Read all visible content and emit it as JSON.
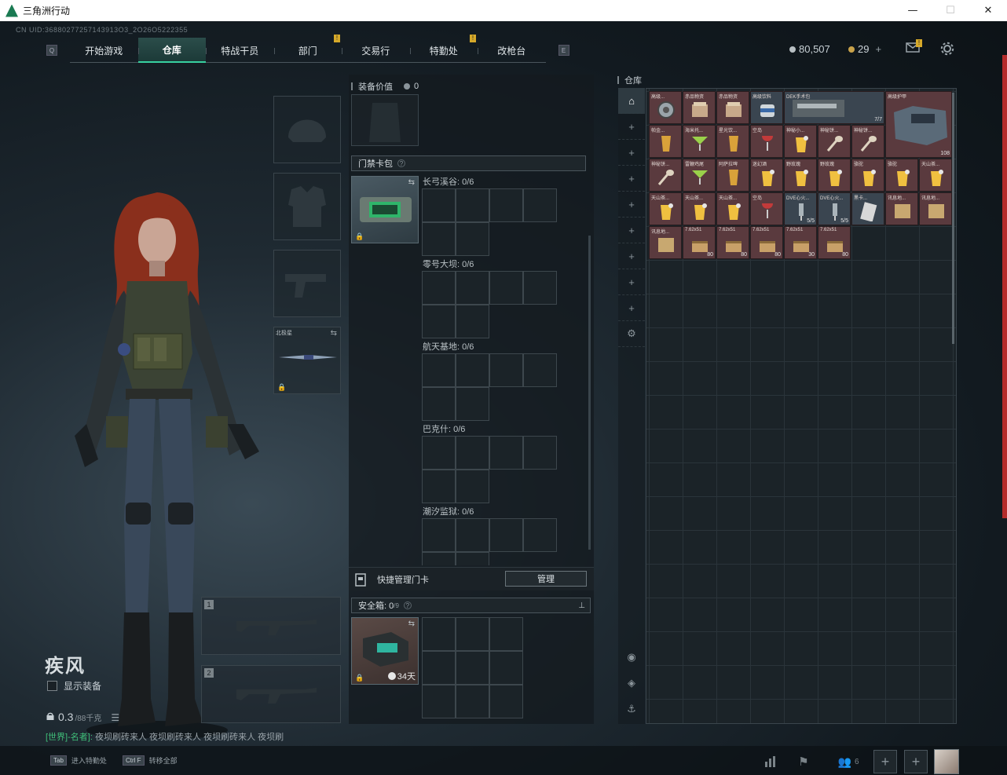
{
  "window": {
    "title": "三角洲行动",
    "controls": [
      "—",
      "☐",
      "✕"
    ]
  },
  "uid": "CN UID:36880277257143913O3_2O26O5222355",
  "nav": {
    "left_key": "Q",
    "right_key": "E",
    "tabs": [
      {
        "label": "开始游戏",
        "active": false,
        "warn": false
      },
      {
        "label": "仓库",
        "active": true,
        "warn": false
      },
      {
        "label": "特战干员",
        "active": false,
        "warn": false
      },
      {
        "label": "部门",
        "active": false,
        "warn": true
      },
      {
        "label": "交易行",
        "active": false,
        "warn": false
      },
      {
        "label": "特勤处",
        "active": false,
        "warn": true
      },
      {
        "label": "改枪台",
        "active": false,
        "warn": false
      }
    ],
    "warn_mark": "!"
  },
  "currency": {
    "silver": "80,507",
    "gold": "29",
    "add": "+",
    "silver_color": "#b9c0c4",
    "gold_color": "#c9a24a"
  },
  "top_icons": {
    "mail": "mail-icon",
    "mail_badge": "!",
    "settings": "gear-icon"
  },
  "character": {
    "name": "疾风",
    "show_equipment": "显示装备",
    "weight_value": "0.3",
    "weight_max": "/88千克"
  },
  "chat": {
    "channel": "[世界]-名者]:",
    "message": "夜坝刷砖来人 夜坝刷砖来人 夜坝刷砖来人 夜坝刷"
  },
  "gear_slots": {
    "melee_label": "北极星"
  },
  "weapon_slots": [
    "1",
    "2"
  ],
  "middle": {
    "equip_value_label": "装备价值",
    "equip_value": "0",
    "keycard_pack": "门禁卡包",
    "help": "?",
    "zones": [
      "长弓溪谷: 0/6",
      "零号大坝: 0/6",
      "航天基地: 0/6",
      "巴克什: 0/6",
      "潮汐监狱: 0/6"
    ],
    "quick_manage": "快捷管理门卡",
    "manage_btn": "管理",
    "safe_box": "安全箱: 0",
    "safe_box_cap": "/9",
    "safe_days": "34天",
    "pin": "📌"
  },
  "warehouse": {
    "title": "仓库",
    "items": [
      {
        "label": "高级...",
        "color": "red",
        "icon": "gear-round"
      },
      {
        "label": "赤品物资",
        "color": "red",
        "icon": "crate"
      },
      {
        "label": "赤品物资",
        "color": "red",
        "icon": "crate"
      },
      {
        "label": "高级饮料",
        "color": "blue",
        "icon": "can"
      },
      {
        "label": "DEK手术包",
        "color": "blue",
        "icon": "medkit",
        "count": "7/7",
        "wide": true
      },
      {
        "label": "高级护甲",
        "color": "red",
        "icon": "armor",
        "count": "108",
        "big": true
      },
      {
        "label": "帕金...",
        "color": "red",
        "icon": "glass"
      },
      {
        "label": "海米托...",
        "color": "red",
        "icon": "cocktail"
      },
      {
        "label": "星光饮...",
        "color": "red",
        "icon": "glass"
      },
      {
        "label": "空岛",
        "color": "red",
        "icon": "wine"
      },
      {
        "label": "神秘小... ",
        "color": "red",
        "icon": "juice"
      },
      {
        "label": "神秘饼...",
        "color": "red",
        "icon": "spoon"
      },
      {
        "label": "神秘饼...",
        "color": "red",
        "icon": "spoon"
      },
      {
        "label": "神秘饼...",
        "color": "red",
        "icon": "spoon"
      },
      {
        "label": "雷鞭鸡尾",
        "color": "red",
        "icon": "cocktail"
      },
      {
        "label": "阿萨拉啤",
        "color": "red",
        "icon": "glass"
      },
      {
        "label": "迷幻酒",
        "color": "red",
        "icon": "juice"
      },
      {
        "label": "野玫瑰",
        "color": "red",
        "icon": "juice"
      },
      {
        "label": "野玫瑰",
        "color": "red",
        "icon": "juice"
      },
      {
        "label": "骆驼",
        "color": "red",
        "icon": "juice"
      },
      {
        "label": "骆驼",
        "color": "red",
        "icon": "juice"
      },
      {
        "label": "天山茶...",
        "color": "red",
        "icon": "juice"
      },
      {
        "label": "天山茶...",
        "color": "red",
        "icon": "juice"
      },
      {
        "label": "天山茶...",
        "color": "red",
        "icon": "juice"
      },
      {
        "label": "天山茶...",
        "color": "red",
        "icon": "juice"
      },
      {
        "label": "空岛",
        "color": "red",
        "icon": "wine"
      },
      {
        "label": "DVE心火...",
        "color": "blue",
        "icon": "injector",
        "count": "5/5"
      },
      {
        "label": "DVE心火...",
        "color": "blue",
        "icon": "injector",
        "count": "5/5"
      },
      {
        "label": "黑卡...",
        "color": "blue",
        "icon": "card"
      },
      {
        "label": "讯息地...",
        "color": "red",
        "icon": "map"
      },
      {
        "label": "讯息地...",
        "color": "red",
        "icon": "map"
      },
      {
        "label": "讯息地...",
        "color": "red",
        "icon": "map"
      },
      {
        "label": "7.62x51",
        "color": "red",
        "icon": "ammo",
        "count": "80"
      },
      {
        "label": "7.62x51",
        "color": "red",
        "icon": "ammo",
        "count": "80"
      },
      {
        "label": "7.62x51",
        "color": "red",
        "icon": "ammo",
        "count": "80"
      },
      {
        "label": "7.62x51",
        "color": "red",
        "icon": "ammo",
        "count": "30"
      },
      {
        "label": "7.62x51",
        "color": "red",
        "icon": "ammo",
        "count": "80"
      }
    ]
  },
  "bottom": {
    "hint1_key": "Tab",
    "hint1_text": "进入特勤处",
    "hint2_key": "Ctrl F",
    "hint2_text": "转移全部",
    "friends_count": "6"
  }
}
